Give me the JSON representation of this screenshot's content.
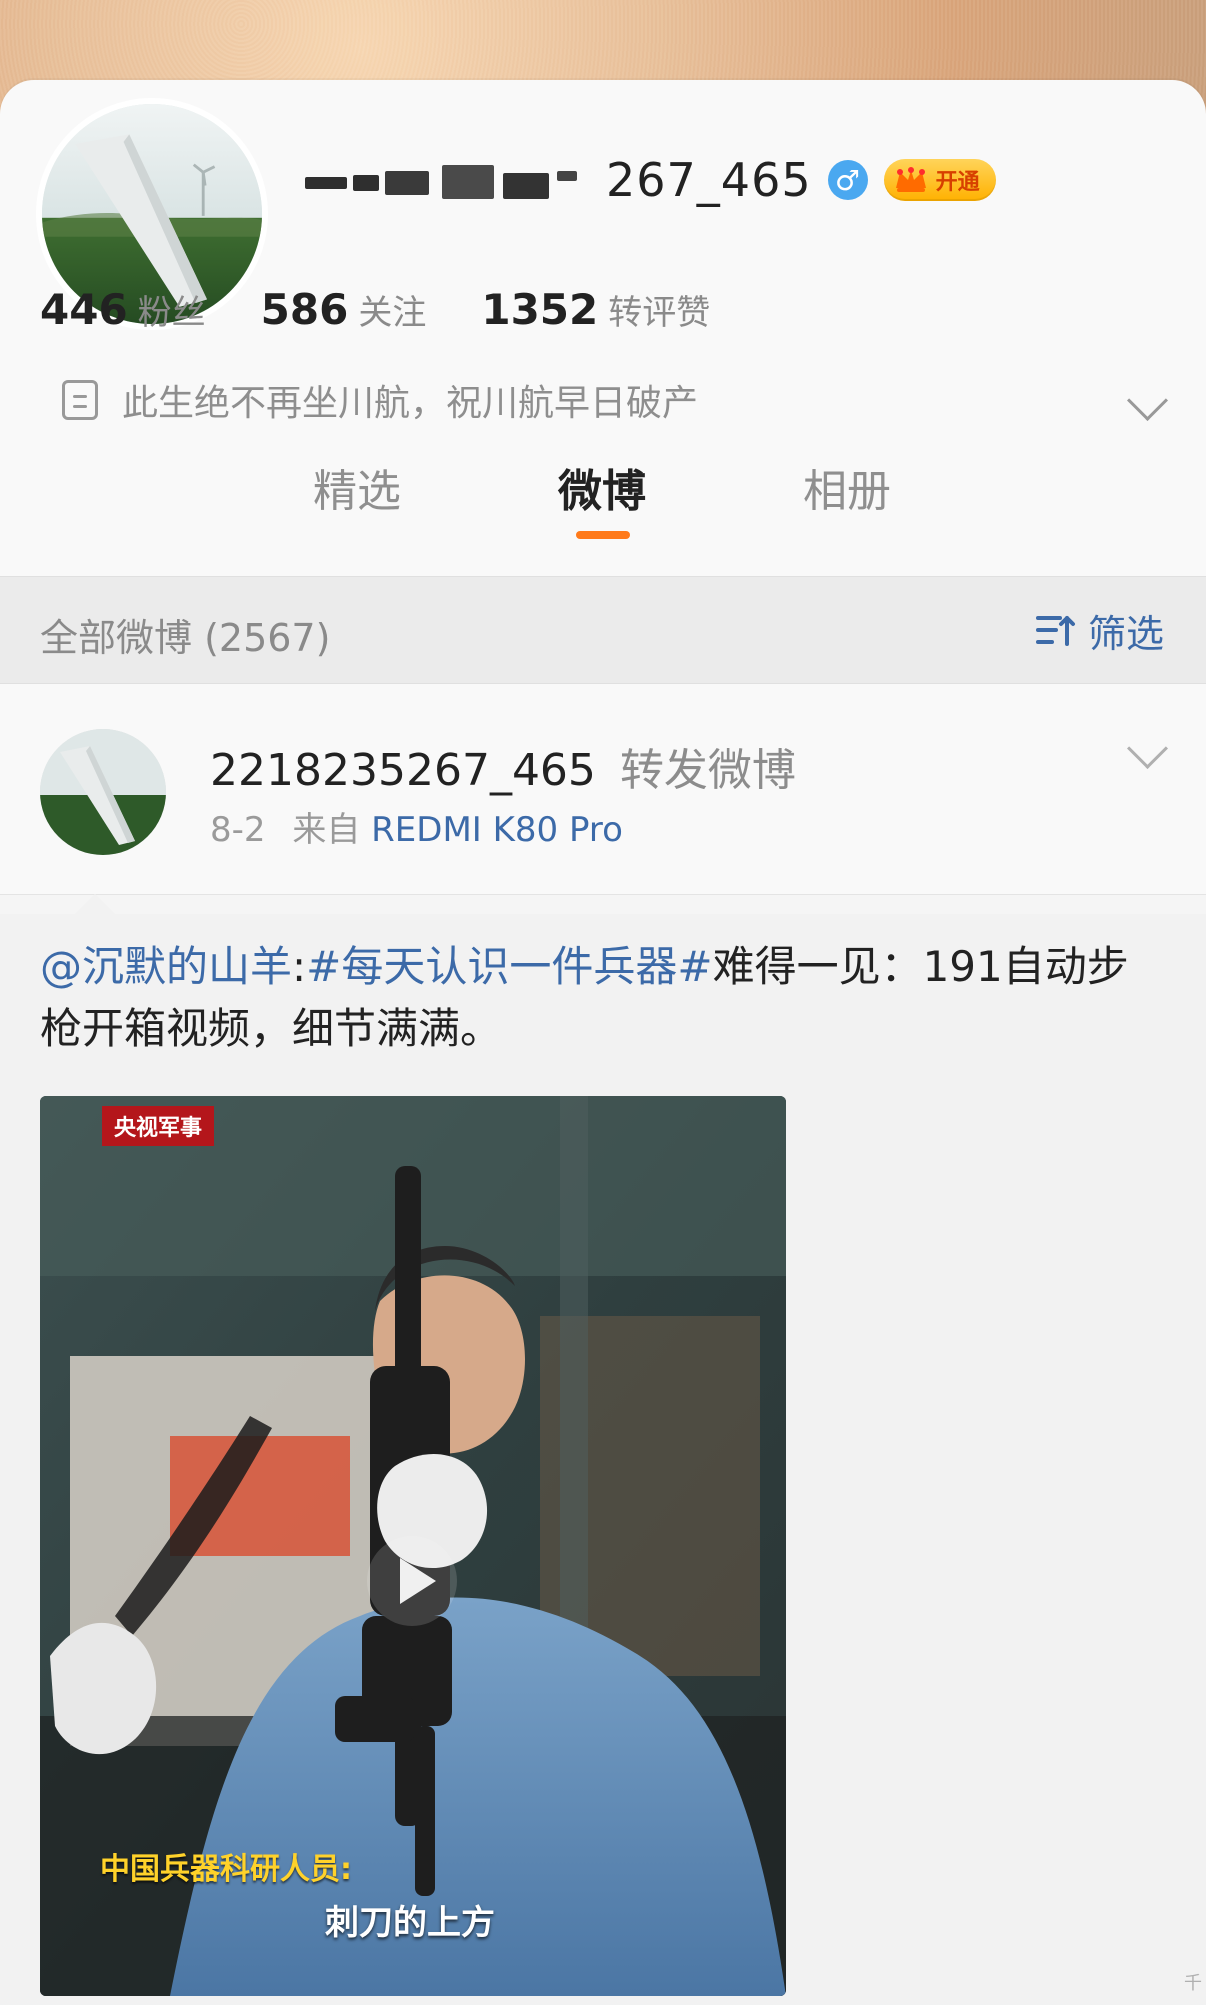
{
  "profile": {
    "name_suffix": "267_465",
    "gender_symbol": "♂",
    "vip_label": "开通",
    "stats": [
      {
        "num": "446",
        "label": "粉丝"
      },
      {
        "num": "586",
        "label": "关注"
      },
      {
        "num": "1352",
        "label": "转评赞"
      }
    ],
    "bio": "此生绝不再坐川航，祝川航早日破产"
  },
  "tabs": [
    "精选",
    "微博",
    "相册"
  ],
  "active_tab": "微博",
  "subheader": {
    "count_text": "全部微博 (2567)",
    "filter_label": "筛选"
  },
  "post": {
    "user": "2218235267_465",
    "action": "转发微博",
    "date": "8-2",
    "source_prefix": "来自",
    "device": "REDMI K80 Pro",
    "text_mention": "@沉默的山羊",
    "text_colon": ":",
    "text_hashtag": "#每天认识一件兵器#",
    "text_rest": "难得一见：191自动步枪开箱视频，细节满满。"
  },
  "video": {
    "logo": "央视军事",
    "subtitle_line1": "中国兵器科研人员:",
    "subtitle_line2": "刺刀的上方"
  },
  "misc": {
    "corner_text": "千"
  },
  "colors": {
    "link_blue": "#3c6aa8",
    "tab_indicator": "#ff7a1a",
    "vip_gold": "#ffb100",
    "gender_blue": "#4aa8f0"
  }
}
